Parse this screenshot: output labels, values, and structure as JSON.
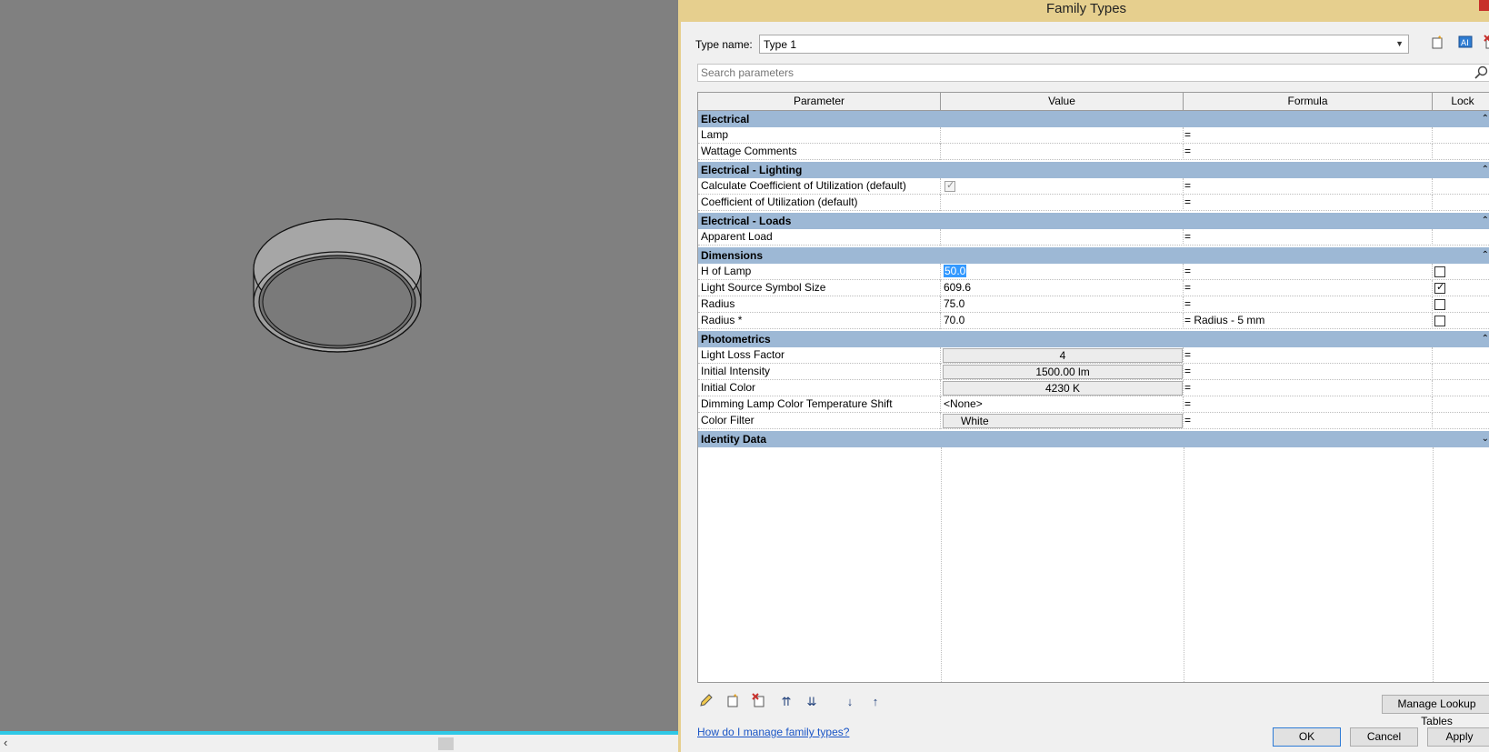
{
  "dialog": {
    "title": "Family Types",
    "type_name_label": "Type name:",
    "type_name_value": "Type 1",
    "search_placeholder": "Search parameters"
  },
  "columns": [
    "Parameter",
    "Value",
    "Formula",
    "Lock"
  ],
  "groups": {
    "electrical": {
      "title": "Electrical",
      "rows": [
        {
          "param": "Lamp",
          "value": "",
          "formula": "="
        },
        {
          "param": "Wattage Comments",
          "value": "",
          "formula": "="
        }
      ]
    },
    "electrical_lighting": {
      "title": "Electrical - Lighting",
      "rows": [
        {
          "param": "Calculate Coefficient of Utilization (default)",
          "value": "",
          "formula": "="
        },
        {
          "param": "Coefficient of Utilization (default)",
          "value": "",
          "formula": "="
        }
      ]
    },
    "electrical_loads": {
      "title": "Electrical - Loads",
      "rows": [
        {
          "param": "Apparent Load",
          "value": "",
          "formula": "="
        }
      ]
    },
    "dimensions": {
      "title": "Dimensions",
      "rows": [
        {
          "param": "H of Lamp",
          "value": "50.0",
          "formula": "="
        },
        {
          "param": "Light Source Symbol Size",
          "value": "609.6",
          "formula": "="
        },
        {
          "param": "Radius",
          "value": "75.0",
          "formula": "="
        },
        {
          "param": "Radius *",
          "value": "70.0",
          "formula": "= Radius - 5 mm"
        }
      ]
    },
    "photometrics": {
      "title": "Photometrics",
      "rows": [
        {
          "param": "Light Loss Factor",
          "value": "4",
          "formula": "="
        },
        {
          "param": "Initial Intensity",
          "value": "1500.00 lm",
          "formula": "="
        },
        {
          "param": "Initial Color",
          "value": "4230 K",
          "formula": "="
        },
        {
          "param": "Dimming Lamp Color Temperature Shift",
          "value": "<None>",
          "formula": "="
        },
        {
          "param": "Color Filter",
          "value": "White",
          "formula": "="
        }
      ]
    },
    "identity_data": {
      "title": "Identity Data"
    }
  },
  "buttons": {
    "manage_lookup": "Manage Lookup Tables",
    "help_link": "How do I manage family types?",
    "ok": "OK",
    "cancel": "Cancel",
    "apply": "Apply"
  },
  "colors": {
    "title_bar": "#e6cf8e",
    "group_header": "#9db8d5",
    "viewport": "#808080",
    "selection": "#3399ff",
    "scroll_accent": "#2fc8e6"
  }
}
